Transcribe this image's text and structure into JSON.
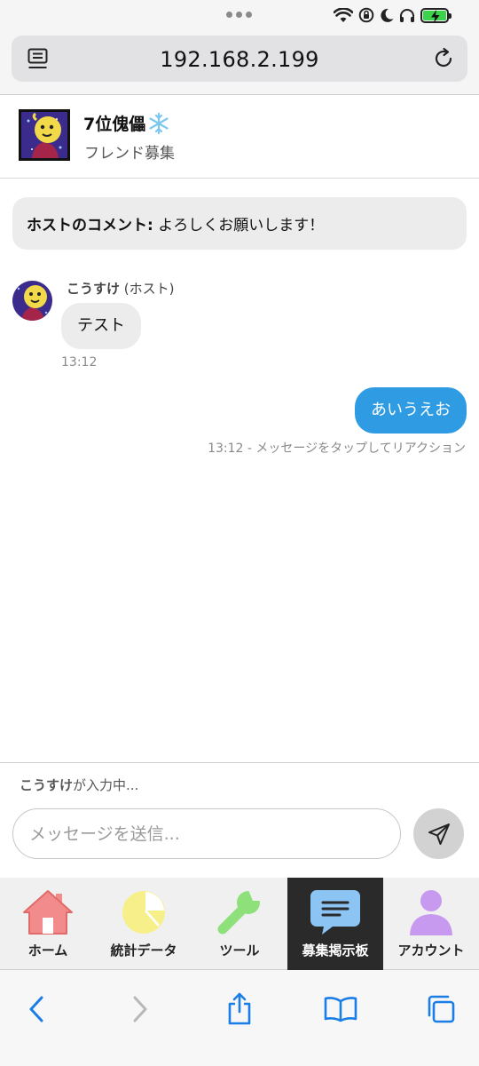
{
  "browser": {
    "url": "192.168.2.199"
  },
  "room": {
    "title": "7位傀儡",
    "subtitle": "フレンド募集"
  },
  "host_comment": {
    "label": "ホストのコメント:",
    "text": "よろしくお願いします！"
  },
  "messages": [
    {
      "sender": "こうすけ",
      "role": "(ホスト)",
      "text": "テスト",
      "time": "13:12"
    },
    {
      "text": "あいうえお",
      "meta": "13:12 - メッセージをタップしてリアクション"
    }
  ],
  "composer": {
    "typing_user": "こうすけ",
    "typing_suffix": "が入力中...",
    "placeholder": "メッセージを送信..."
  },
  "nav": {
    "items": [
      {
        "label": "ホーム",
        "icon": "home-icon",
        "color": "#f28b8b"
      },
      {
        "label": "統計データ",
        "icon": "pie-chart-icon",
        "color": "#f7f08a"
      },
      {
        "label": "ツール",
        "icon": "wrench-icon",
        "color": "#8ee07a"
      },
      {
        "label": "募集掲示板",
        "icon": "chat-bubble-icon",
        "color": "#8cc4f4",
        "active": true
      },
      {
        "label": "アカウント",
        "icon": "person-icon",
        "color": "#c79af0"
      }
    ]
  },
  "colors": {
    "accent": "#2f9be3",
    "active_nav": "#2a2a2a",
    "safari_blue": "#1a7ee6"
  }
}
